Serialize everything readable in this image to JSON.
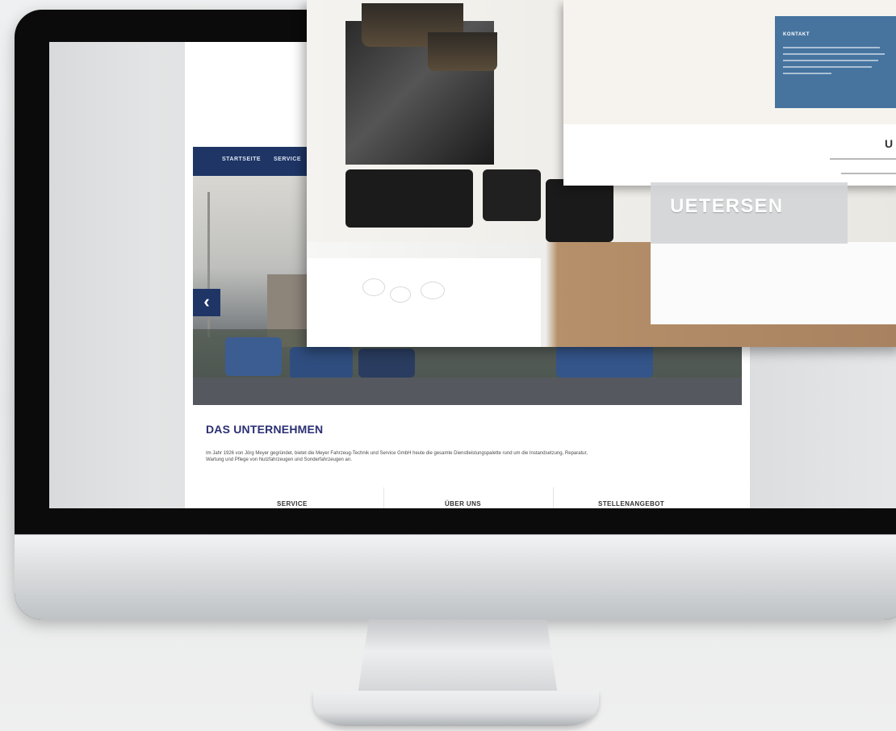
{
  "navigation": {
    "items": [
      "STARTSEITE",
      "SERVICE"
    ]
  },
  "slider": {
    "prev_arrow": "‹",
    "dots": [
      false,
      true,
      false,
      false
    ]
  },
  "intro": {
    "title": "DAS UNTERNEHMEN",
    "text": "Im Jahr 1926 von Jörg Meyer gegründet, bietet die Meyer Fahrzeug-Technik und Service GmbH heute die gesamte Dienstleistungspalette rund um die Instandsetzung, Reparatur, Wartung und Pflege von Nutzfahrzeugen und Sonderfahrzeugen an."
  },
  "columns": {
    "headings": [
      "SERVICE",
      "ÜBER UNS",
      "STELLENANGEBOT"
    ]
  },
  "city_card": {
    "name": "UETERSEN"
  },
  "web_card": {
    "box_title": "KONTAKT",
    "heading": "U"
  },
  "colors": {
    "brand_navy": "#1e3566",
    "heading_purple": "#2b2f74",
    "info_box_blue": "#46749f"
  },
  "icons": {
    "prev_arrow": "chevron-left-icon"
  }
}
